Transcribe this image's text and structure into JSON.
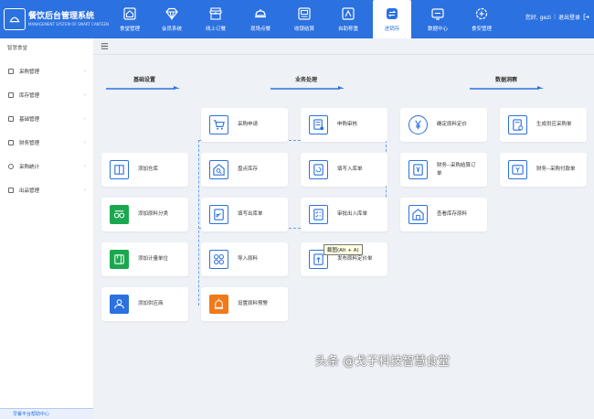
{
  "app": {
    "title": "餐饮后台管理系统",
    "subtitle": "MANAGEMENT SYSTEM OF SMART CANTEEN",
    "logo_text": "智慧食堂"
  },
  "nav": [
    {
      "label": "食堂管理",
      "icon": "home-icon"
    },
    {
      "label": "会员系统",
      "icon": "diamond-icon"
    },
    {
      "label": "线上订餐",
      "icon": "store-icon"
    },
    {
      "label": "现场点餐",
      "icon": "cloche-icon"
    },
    {
      "label": "收银结算",
      "icon": "cashier-icon"
    },
    {
      "label": "自助称重",
      "icon": "scale-icon"
    },
    {
      "label": "进销存",
      "icon": "exchange-icon",
      "active": true
    },
    {
      "label": "数据中心",
      "icon": "monitor-icon"
    },
    {
      "label": "食安管理",
      "icon": "safety-icon"
    }
  ],
  "user": {
    "greeting": "您好, gezi",
    "logout": "退出登录"
  },
  "sidebar": {
    "title": "智慧食堂",
    "items": [
      {
        "label": "采购管理"
      },
      {
        "label": "库存管理"
      },
      {
        "label": "基础管理"
      },
      {
        "label": "财务管理"
      },
      {
        "label": "采购统计"
      },
      {
        "label": "出品管理"
      }
    ],
    "bottom": "早餐平台帮助中心"
  },
  "sections": {
    "basic": "基础设置",
    "business": "业务处理",
    "data": "数据洞察"
  },
  "cards": {
    "purchase_request": "采购申请",
    "purchase_review": "申购审核",
    "confirm_price": "确定原料定价",
    "generate_order": "生成供应采购单",
    "add_warehouse": "添加仓库",
    "inventory_check": "盘点库存",
    "fill_inbound": "填写入库单",
    "finance_settle_1": "财务--采购结算订",
    "finance_settle_2": "单",
    "finance_pay": "财务--采购付款单",
    "add_category": "添加原料分类",
    "fill_outbound": "填写出库单",
    "review_inout": "审批出入库单",
    "view_stock": "查看库存原料",
    "add_unit": "添加计量单位",
    "import_material": "导入原料",
    "publish_price": "发布原料定价单",
    "add_supplier": "添加供应商",
    "set_warning": "设置原料预警"
  },
  "tooltip": "截图(Alt + A)",
  "watermark": "头条 @戈子科技智慧食堂",
  "colors": {
    "primary": "#2b71e0",
    "green": "#1aa84f",
    "orange": "#f07a1a"
  }
}
